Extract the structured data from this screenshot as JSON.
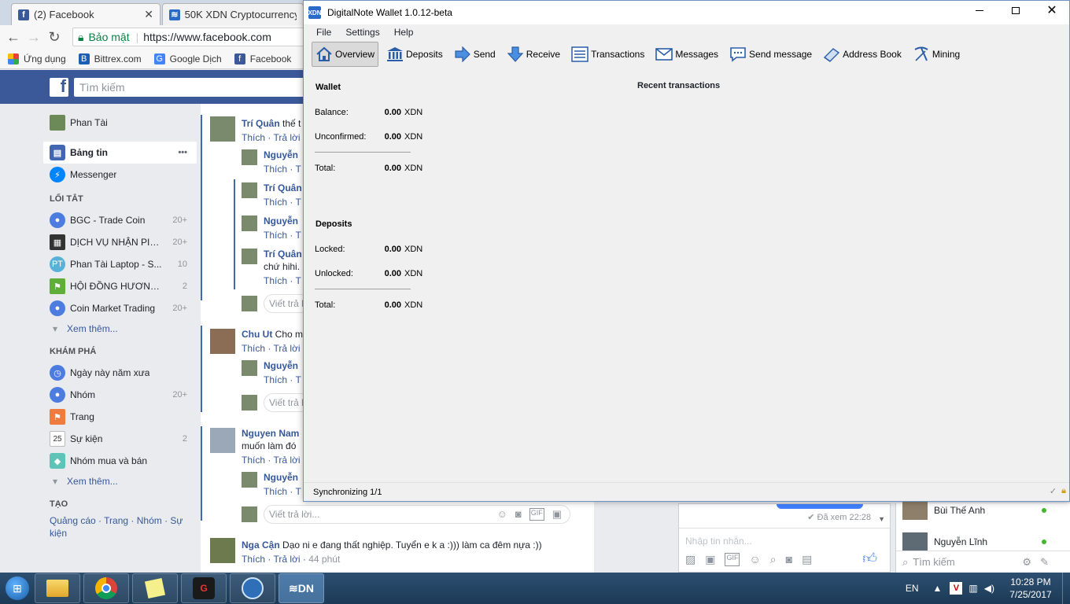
{
  "browser": {
    "tabs": [
      {
        "title": "(2) Facebook",
        "favicon": "f",
        "active": true
      },
      {
        "title": "50K XDN Cryptocurrency",
        "favicon": "xdn"
      }
    ],
    "secure_label": "Bảo mật",
    "url": "https://www.facebook.com",
    "bookmarks": [
      {
        "label": "Ứng dụng",
        "icon": "apps-grid-icon"
      },
      {
        "label": "Bittrex.com",
        "icon": "bittrex-icon"
      },
      {
        "label": "Google Dịch",
        "icon": "google-translate-icon"
      },
      {
        "label": "Facebook",
        "icon": "facebook-icon"
      }
    ]
  },
  "facebook": {
    "search_placeholder": "Tìm kiếm",
    "profile_name": "Phan Tài",
    "main_items": [
      {
        "label": "Bảng tin",
        "more": "•••"
      },
      {
        "label": "Messenger"
      }
    ],
    "shortcuts_heading": "LỐI TẮT",
    "shortcuts": [
      {
        "label": "BGC - Trade Coin",
        "count": "20+"
      },
      {
        "label": "DỊCH VỤ NHẬN PIN ...",
        "count": "20+"
      },
      {
        "label": "Phan Tài Laptop - S...",
        "count": "10"
      },
      {
        "label": "HỘI ĐỒNG HƯƠNG...",
        "count": "2"
      },
      {
        "label": "Coin Market Trading",
        "count": "20+"
      }
    ],
    "see_more": "Xem thêm...",
    "explore_heading": "KHÁM PHÁ",
    "explore": [
      {
        "label": "Ngày này năm xưa",
        "count": ""
      },
      {
        "label": "Nhóm",
        "count": "20+"
      },
      {
        "label": "Trang",
        "count": ""
      },
      {
        "label": "Sự kiện",
        "count": "2"
      },
      {
        "label": "Nhóm mua và bán",
        "count": ""
      }
    ],
    "create_heading": "TẠO",
    "create_links": "Quảng cáo · Trang · Nhóm · Sự kiện",
    "feed": {
      "like": "Thích",
      "reply": "Trả lời",
      "reply_short": "Trả lời",
      "comments": [
        {
          "name": "Trí Quân",
          "text": "thế t"
        },
        {
          "name": "Nguyễn"
        },
        {
          "name": "Trí Quân"
        },
        {
          "name": "Nguyễn"
        },
        {
          "name": "Trí Quân",
          "text2": "chứ hihi."
        },
        {
          "name": "Chu Ut",
          "text": "Cho m"
        },
        {
          "name": "Nguyễn"
        },
        {
          "name": "Nguyen Nam",
          "text2": "muốn làm đó"
        },
        {
          "name": "Nguyễn"
        },
        {
          "name": "Nga Cận",
          "text": "Dạo ni e đang thất nghiệp. Tuyển e k a :))) làm ca đêm nựa :))",
          "time": "44 phút"
        }
      ],
      "reply_placeholder": "Viết trả lời...",
      "reply_placeholder_short": "Viết trả lờ",
      "reply_icons": [
        "emoji-icon",
        "camera-icon",
        "gif-icon",
        "sticker-icon"
      ]
    },
    "chat": {
      "seen": "Đã xem 22:28",
      "input_placeholder": "Nhập tin nhắn..."
    },
    "contacts": [
      {
        "name": "Bùi Thế Anh"
      },
      {
        "name": "Nguyễn Lĩnh"
      }
    ],
    "contacts_search": "Tìm kiếm"
  },
  "wallet": {
    "title": "DigitalNote Wallet 1.0.12-beta",
    "menu": [
      "File",
      "Settings",
      "Help"
    ],
    "toolbar": [
      "Overview",
      "Deposits",
      "Send",
      "Receive",
      "Transactions",
      "Messages",
      "Send message",
      "Address Book",
      "Mining"
    ],
    "wallet_title": "Wallet",
    "balance": {
      "label": "Balance:",
      "value": "0.00",
      "unit": "XDN"
    },
    "unconfirmed": {
      "label": "Unconfirmed:",
      "value": "0.00",
      "unit": "XDN"
    },
    "total": {
      "label": "Total:",
      "value": "0.00",
      "unit": "XDN"
    },
    "deposits_title": "Deposits",
    "locked": {
      "label": "Locked:",
      "value": "0.00",
      "unit": "XDN"
    },
    "unlocked": {
      "label": "Unlocked:",
      "value": "0.00",
      "unit": "XDN"
    },
    "deposit_total": {
      "label": "Total:",
      "value": "0.00",
      "unit": "XDN"
    },
    "recent_title": "Recent transactions",
    "status": "Synchronizing 1/1"
  },
  "taskbar": {
    "language": "EN",
    "time": "10:28 PM",
    "date": "7/25/2017"
  },
  "colors": {
    "facebook_blue": "#3b5998",
    "link_blue": "#365899",
    "taskbar": "#1c3a57"
  }
}
